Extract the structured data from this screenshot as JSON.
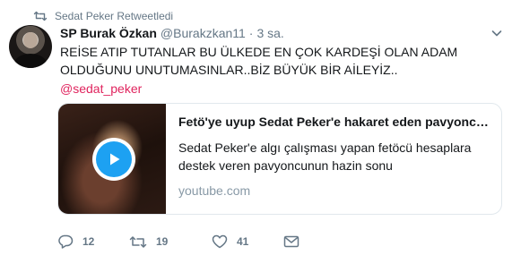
{
  "context": {
    "label": "Sedat Peker Retweetledi",
    "icon": "retweet-icon"
  },
  "author": {
    "name": "SP Burak Özkan",
    "handle": "@Burakzkan11",
    "separator": "·",
    "time": "3 sa."
  },
  "tweet": {
    "line1": "REİSE ATIP TUTANLAR BU ÜLKEDE EN ÇOK KARDEŞİ OLAN ADAM",
    "line2": "OLDUĞUNU UNUTUMASINLAR..BİZ BÜYÜK BİR AİLEYİZ..",
    "mention": "@sedat_peker"
  },
  "card": {
    "title": "Fetö'ye uyup Sedat Peker'e hakaret eden pavyoncu...",
    "description": "Sedat Peker'e algı çalışması yapan fetöcü hesaplara destek veren pavyoncunun hazin sonu",
    "domain": "youtube.com"
  },
  "actions": {
    "reply_count": "12",
    "retweet_count": "19",
    "like_count": "41"
  },
  "colors": {
    "mention": "#e0245e",
    "play_button": "#1da1f2",
    "muted": "#657786"
  }
}
